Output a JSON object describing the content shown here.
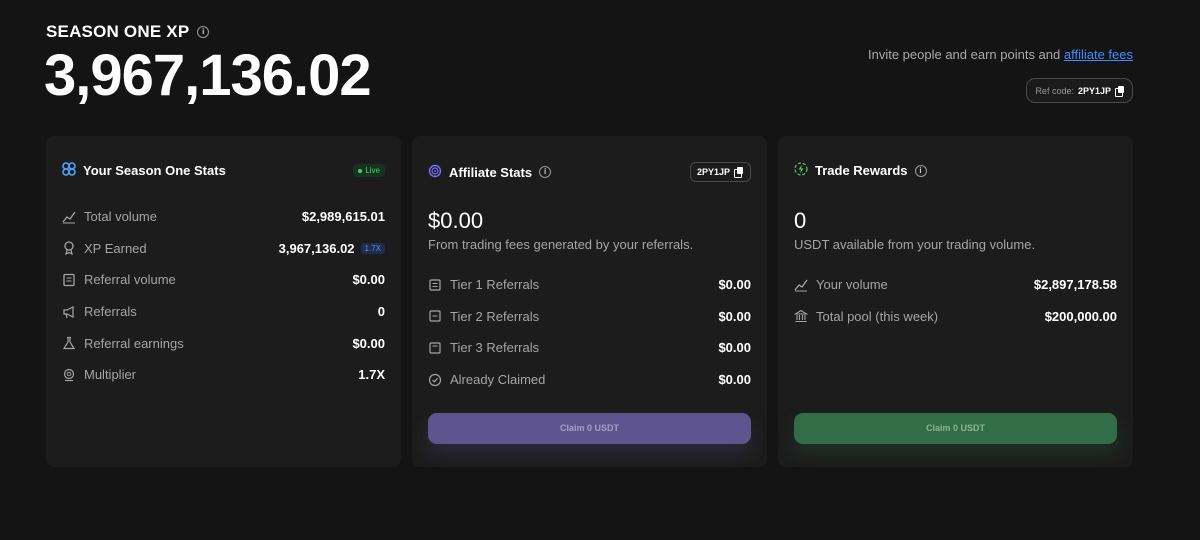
{
  "header": {
    "title": "SEASON ONE XP",
    "info_icon": "info-icon",
    "xp_value": "3,967,136.02"
  },
  "invite": {
    "text": "Invite people and earn points and ",
    "link_text": "affiliate fees",
    "link_color": "#3d8bff",
    "ref_label": "Ref code:",
    "ref_code": "2PY1JP"
  },
  "season_stats": {
    "title": "Your Season One Stats",
    "icon": "season-logo-icon",
    "live_label": "Live",
    "rows": [
      {
        "label": "Total volume",
        "value": "$2,989,615.01",
        "icon": "chart-up-icon"
      },
      {
        "label": "XP Earned",
        "value": "3,967,136.02",
        "icon": "award-icon",
        "badge": "1.7X"
      },
      {
        "label": "Referral volume",
        "value": "$0.00",
        "icon": "receipt-icon"
      },
      {
        "label": "Referrals",
        "value": "0",
        "icon": "megaphone-icon"
      },
      {
        "label": "Referral earnings",
        "value": "$0.00",
        "icon": "flask-icon"
      },
      {
        "label": "Multiplier",
        "value": "1.7X",
        "icon": "medal-icon"
      }
    ]
  },
  "affiliate_stats": {
    "title": "Affiliate Stats",
    "icon": "swirl-icon",
    "code": "2PY1JP",
    "amount": "$0.00",
    "subtitle": "From trading fees generated by your referrals.",
    "rows": [
      {
        "label": "Tier 1 Referrals",
        "value": "$0.00",
        "icon": "tier1-icon"
      },
      {
        "label": "Tier 2 Referrals",
        "value": "$0.00",
        "icon": "tier2-icon"
      },
      {
        "label": "Tier 3 Referrals",
        "value": "$0.00",
        "icon": "tier3-icon"
      },
      {
        "label": "Already Claimed",
        "value": "$0.00",
        "icon": "check-circle-icon"
      }
    ],
    "claim_label": "Claim 0 USDT",
    "accent": "#5e558f"
  },
  "trade_rewards": {
    "title": "Trade Rewards",
    "icon": "lightning-icon",
    "amount": "0",
    "subtitle": "USDT available from your trading volume.",
    "rows": [
      {
        "label": "Your volume",
        "value": "$2,897,178.58",
        "icon": "chart-up-icon"
      },
      {
        "label": "Total pool (this week)",
        "value": "$200,000.00",
        "icon": "bank-icon"
      }
    ],
    "claim_label": "Claim 0 USDT",
    "accent": "#336d47"
  }
}
